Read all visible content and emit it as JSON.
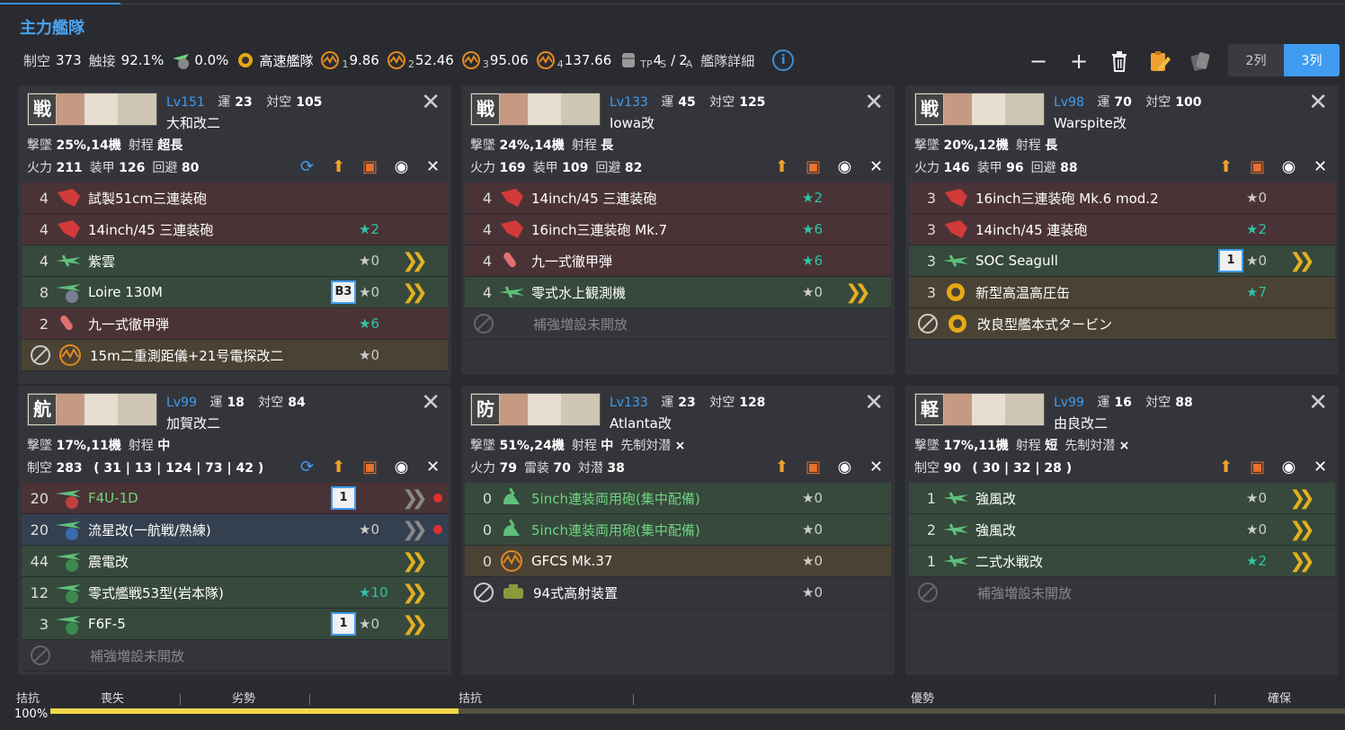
{
  "fleet_title": "主力艦隊",
  "stats": {
    "air_label": "制空",
    "air_value": "373",
    "contact_label": "触接",
    "contact_value": "92.1%",
    "night_contact_value": "0.0%",
    "speed_label": "高速艦隊",
    "los": [
      {
        "sub": "1",
        "value": "9.86"
      },
      {
        "sub": "2",
        "value": "52.46"
      },
      {
        "sub": "3",
        "value": "95.06"
      },
      {
        "sub": "4",
        "value": "137.66"
      }
    ],
    "tp_label": "TP",
    "tp_s_value": "4",
    "tp_s_sub": "S",
    "tp_sep": "/",
    "tp_a_value": "2",
    "tp_a_sub": "A",
    "detail_label": "艦隊詳細",
    "info_glyph": "i"
  },
  "toolbar": {
    "minus": "−",
    "plus": "+",
    "delete": "🗑",
    "edit": "✎",
    "cards": "▰"
  },
  "columns": {
    "two": "2列",
    "three": "3列",
    "selected": "3列"
  },
  "ships": [
    {
      "type": "戦",
      "level": "Lv151",
      "luck_label": "運",
      "luck": "23",
      "aa_label": "対空",
      "aa": "105",
      "name": "大和改二",
      "r3": [
        {
          "k": "撃墜",
          "v": "25%,14機"
        },
        {
          "k": "射程",
          "v": "超長"
        }
      ],
      "r4": [
        {
          "k": "火力",
          "v": "211"
        },
        {
          "k": "装甲",
          "v": "126"
        },
        {
          "k": "回避",
          "v": "80"
        }
      ],
      "sync": true,
      "equips": [
        {
          "slot": "4",
          "name": "試製51cm三連装砲",
          "color": "red",
          "icon": "main-gun",
          "prof": "",
          "prof_teal": false,
          "chev": "",
          "badge": "",
          "dot": false
        },
        {
          "slot": "4",
          "name": "14inch/45 三連装砲",
          "color": "red",
          "icon": "main-gun",
          "prof": "★2",
          "prof_teal": true,
          "chev": "",
          "badge": "",
          "dot": false
        },
        {
          "slot": "4",
          "name": "紫雲",
          "color": "green",
          "icon": "seaplane",
          "prof": "★0",
          "prof_teal": false,
          "chev": "❯❯",
          "badge": "",
          "dot": false
        },
        {
          "slot": "8",
          "name": "Loire 130M",
          "color": "green",
          "icon": "night-seaplane",
          "prof": "★0",
          "prof_teal": false,
          "chev": "❯❯",
          "badge": "B3",
          "dot": false
        },
        {
          "slot": "2",
          "name": "九一式徹甲弾",
          "color": "red",
          "icon": "ap-shell",
          "prof": "★6",
          "prof_teal": true,
          "chev": "",
          "badge": "",
          "dot": false
        },
        {
          "slot": "",
          "ex": true,
          "name": "15m二重測距儀+21号電探改二",
          "color": "brown",
          "icon": "radar",
          "prof": "★0",
          "prof_teal": false,
          "chev": "",
          "badge": "",
          "dot": false
        }
      ]
    },
    {
      "type": "戦",
      "level": "Lv133",
      "luck_label": "運",
      "luck": "45",
      "aa_label": "対空",
      "aa": "125",
      "name": "Iowa改",
      "r3": [
        {
          "k": "撃墜",
          "v": "24%,14機"
        },
        {
          "k": "射程",
          "v": "長"
        }
      ],
      "r4": [
        {
          "k": "火力",
          "v": "169"
        },
        {
          "k": "装甲",
          "v": "109"
        },
        {
          "k": "回避",
          "v": "82"
        }
      ],
      "sync": false,
      "equips": [
        {
          "slot": "4",
          "name": "14inch/45 三連装砲",
          "color": "red",
          "icon": "main-gun",
          "prof": "★2",
          "prof_teal": true,
          "chev": "",
          "badge": "",
          "dot": false
        },
        {
          "slot": "4",
          "name": "16inch三連装砲 Mk.7",
          "color": "red",
          "icon": "main-gun",
          "prof": "★6",
          "prof_teal": true,
          "chev": "",
          "badge": "",
          "dot": false
        },
        {
          "slot": "4",
          "name": "九一式徹甲弾",
          "color": "red",
          "icon": "ap-shell",
          "prof": "★6",
          "prof_teal": true,
          "chev": "",
          "badge": "",
          "dot": false
        },
        {
          "slot": "4",
          "name": "零式水上観測機",
          "color": "green",
          "icon": "seaplane",
          "prof": "★0",
          "prof_teal": false,
          "chev": "❯❯",
          "badge": "",
          "dot": false
        },
        {
          "slot": "",
          "ex": true,
          "disabled": true,
          "name": "補強増設未開放",
          "color": "none",
          "icon": "",
          "prof": "",
          "prof_teal": false,
          "chev": "",
          "badge": "",
          "dot": false
        }
      ]
    },
    {
      "type": "戦",
      "level": "Lv98",
      "luck_label": "運",
      "luck": "70",
      "aa_label": "対空",
      "aa": "100",
      "name": "Warspite改",
      "r3": [
        {
          "k": "撃墜",
          "v": "20%,12機"
        },
        {
          "k": "射程",
          "v": "長"
        }
      ],
      "r4": [
        {
          "k": "火力",
          "v": "146"
        },
        {
          "k": "装甲",
          "v": "96"
        },
        {
          "k": "回避",
          "v": "88"
        }
      ],
      "sync": false,
      "equips": [
        {
          "slot": "3",
          "name": "16inch三連装砲 Mk.6 mod.2",
          "color": "red",
          "icon": "main-gun",
          "prof": "★0",
          "prof_teal": false,
          "chev": "",
          "badge": "",
          "dot": false
        },
        {
          "slot": "3",
          "name": "14inch/45 連装砲",
          "color": "red",
          "icon": "main-gun",
          "prof": "★2",
          "prof_teal": true,
          "chev": "",
          "badge": "",
          "dot": false
        },
        {
          "slot": "3",
          "name": "SOC Seagull",
          "color": "green",
          "icon": "seaplane",
          "prof": "★0",
          "prof_teal": false,
          "chev": "❯❯",
          "badge": "1",
          "dot": false
        },
        {
          "slot": "3",
          "name": "新型高温高圧缶",
          "color": "brown",
          "icon": "boiler",
          "prof": "★7",
          "prof_teal": true,
          "chev": "",
          "badge": "",
          "dot": false
        },
        {
          "slot": "",
          "ex": true,
          "name": "改良型艦本式タービン",
          "color": "brown",
          "icon": "boiler",
          "prof": "",
          "prof_teal": false,
          "chev": "",
          "badge": "",
          "dot": false
        }
      ]
    },
    {
      "type": "航",
      "level": "Lv99",
      "luck_label": "運",
      "luck": "18",
      "aa_label": "対空",
      "aa": "84",
      "name": "加賀改二",
      "r3": [
        {
          "k": "撃墜",
          "v": "17%,11機"
        },
        {
          "k": "射程",
          "v": "中"
        }
      ],
      "r4": [
        {
          "k": "制空",
          "v": "283"
        },
        {
          "k": "",
          "v": "( 31 | 13 | 124 | 73 | 42 )"
        }
      ],
      "sync": true,
      "equips": [
        {
          "slot": "20",
          "name": "F4U-1D",
          "color": "red",
          "icon": "fighter-bomber",
          "prof": "",
          "prof_teal": false,
          "chev": "❯❯",
          "chev_grey": true,
          "badge": "1",
          "dot": true,
          "green_name": true
        },
        {
          "slot": "20",
          "name": "流星改(一航戦/熟練)",
          "color": "blue",
          "icon": "torpedo-bomber",
          "prof": "★0",
          "prof_teal": false,
          "chev": "❯❯",
          "chev_grey": true,
          "badge": "",
          "dot": true
        },
        {
          "slot": "44",
          "name": "震電改",
          "color": "green",
          "icon": "fighter",
          "prof": "",
          "prof_teal": false,
          "chev": "❯❯",
          "badge": "",
          "dot": false
        },
        {
          "slot": "12",
          "name": "零式艦戦53型(岩本隊)",
          "color": "green",
          "icon": "fighter",
          "prof": "★10",
          "prof_teal": true,
          "chev": "❯❯",
          "badge": "",
          "dot": false
        },
        {
          "slot": "3",
          "name": "F6F-5",
          "color": "green",
          "icon": "fighter",
          "prof": "★0",
          "prof_teal": false,
          "chev": "❯❯",
          "badge": "1",
          "dot": false
        },
        {
          "slot": "",
          "ex": true,
          "disabled": true,
          "name": "補強増設未開放",
          "color": "none",
          "icon": "",
          "prof": "",
          "prof_teal": false,
          "chev": "",
          "badge": "",
          "dot": false
        }
      ]
    },
    {
      "type": "防",
      "level": "Lv133",
      "luck_label": "運",
      "luck": "23",
      "aa_label": "対空",
      "aa": "128",
      "name": "Atlanta改",
      "r3": [
        {
          "k": "撃墜",
          "v": "51%,24機"
        },
        {
          "k": "射程",
          "v": "中"
        },
        {
          "k": "先制対潜",
          "v": "×"
        }
      ],
      "r4": [
        {
          "k": "火力",
          "v": "79"
        },
        {
          "k": "雷装",
          "v": "70"
        },
        {
          "k": "対潜",
          "v": "38"
        }
      ],
      "sync": false,
      "equips": [
        {
          "slot": "0",
          "name": "5inch連装両用砲(集中配備)",
          "color": "green",
          "icon": "aa-gun",
          "prof": "★0",
          "prof_teal": false,
          "chev": "",
          "badge": "",
          "dot": false,
          "green_name": true
        },
        {
          "slot": "0",
          "name": "5inch連装両用砲(集中配備)",
          "color": "green",
          "icon": "aa-gun",
          "prof": "★0",
          "prof_teal": false,
          "chev": "",
          "badge": "",
          "dot": false,
          "green_name": true
        },
        {
          "slot": "0",
          "name": "GFCS Mk.37",
          "color": "brown",
          "icon": "radar",
          "prof": "★0",
          "prof_teal": false,
          "chev": "",
          "badge": "",
          "dot": false
        },
        {
          "slot": "",
          "ex": true,
          "name": "94式高射装置",
          "color": "none",
          "icon": "aa-director",
          "prof": "★0",
          "prof_teal": false,
          "chev": "",
          "badge": "",
          "dot": false
        }
      ]
    },
    {
      "type": "軽",
      "level": "Lv99",
      "luck_label": "運",
      "luck": "16",
      "aa_label": "対空",
      "aa": "88",
      "name": "由良改二",
      "r3": [
        {
          "k": "撃墜",
          "v": "17%,11機"
        },
        {
          "k": "射程",
          "v": "短"
        },
        {
          "k": "先制対潜",
          "v": "×"
        }
      ],
      "r4": [
        {
          "k": "制空",
          "v": "90"
        },
        {
          "k": "",
          "v": "( 30 | 32 | 28 )"
        }
      ],
      "sync": false,
      "equips": [
        {
          "slot": "1",
          "name": "強風改",
          "color": "green",
          "icon": "seaplane",
          "prof": "★0",
          "prof_teal": false,
          "chev": "❯❯",
          "badge": "",
          "dot": false
        },
        {
          "slot": "2",
          "name": "強風改",
          "color": "green",
          "icon": "seaplane",
          "prof": "★0",
          "prof_teal": false,
          "chev": "❯❯",
          "badge": "",
          "dot": false
        },
        {
          "slot": "1",
          "name": "二式水戦改",
          "color": "green",
          "icon": "seaplane",
          "prof": "★2",
          "prof_teal": true,
          "chev": "❯❯",
          "badge": "",
          "dot": false
        },
        {
          "slot": "",
          "ex": true,
          "disabled": true,
          "name": "補強増設未開放",
          "color": "none",
          "icon": "",
          "prof": "",
          "prof_teal": false,
          "chev": "",
          "badge": "",
          "dot": false
        }
      ]
    }
  ],
  "air_state": {
    "labels": [
      "拮抗",
      "喪失",
      "劣勢",
      "拮抗",
      "優勢",
      "確保"
    ],
    "percent_label": "100%",
    "fill_fraction": 0.315
  },
  "colors": {
    "accent": "#3f9cf0",
    "bar_fill": "#f0d84a"
  }
}
